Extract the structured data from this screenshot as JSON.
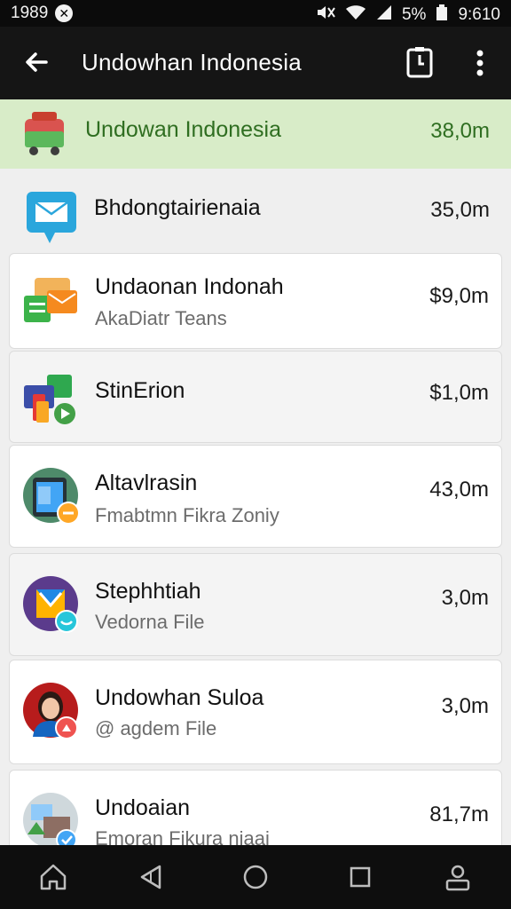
{
  "status_bar": {
    "time_left": "1989",
    "battery_percent": "5%",
    "clock": "9:610"
  },
  "app_bar": {
    "title": "Undowhan Indonesia"
  },
  "list": [
    {
      "name": "Undowan Indonesia",
      "subtitle": "",
      "size": "38,0m",
      "icon": "bus-icon",
      "highlight": true
    },
    {
      "name": "Bhdongtairienaia",
      "subtitle": "",
      "size": "35,0m",
      "icon": "mail-icon"
    },
    {
      "name": "Undaonan Indonah",
      "subtitle": "AkaDiatr Teans",
      "size": "$9,0m",
      "icon": "folder-icon"
    },
    {
      "name": "StinErion",
      "subtitle": "",
      "size": "$1,0m",
      "icon": "media-icon"
    },
    {
      "name": "Altavlrasin",
      "subtitle": "Fmabtmn Fikra Zoniy",
      "size": "43,0m",
      "icon": "tablet-icon"
    },
    {
      "name": "Stephhtiah",
      "subtitle": "Vedorna File",
      "size": "3,0m",
      "icon": "app-m-icon"
    },
    {
      "name": "Undowhan Suloa",
      "subtitle": "@ agdem File",
      "size": "3,0m",
      "icon": "avatar-icon"
    },
    {
      "name": "Undoaian",
      "subtitle": "Emoran Fikura niaai",
      "size": "81,7m",
      "icon": "photo-icon"
    }
  ],
  "nav_bar": {
    "home": "home-icon",
    "back": "back-triangle-icon",
    "recents_circle": "circle-icon",
    "overview": "square-icon",
    "profile": "person-icon"
  }
}
